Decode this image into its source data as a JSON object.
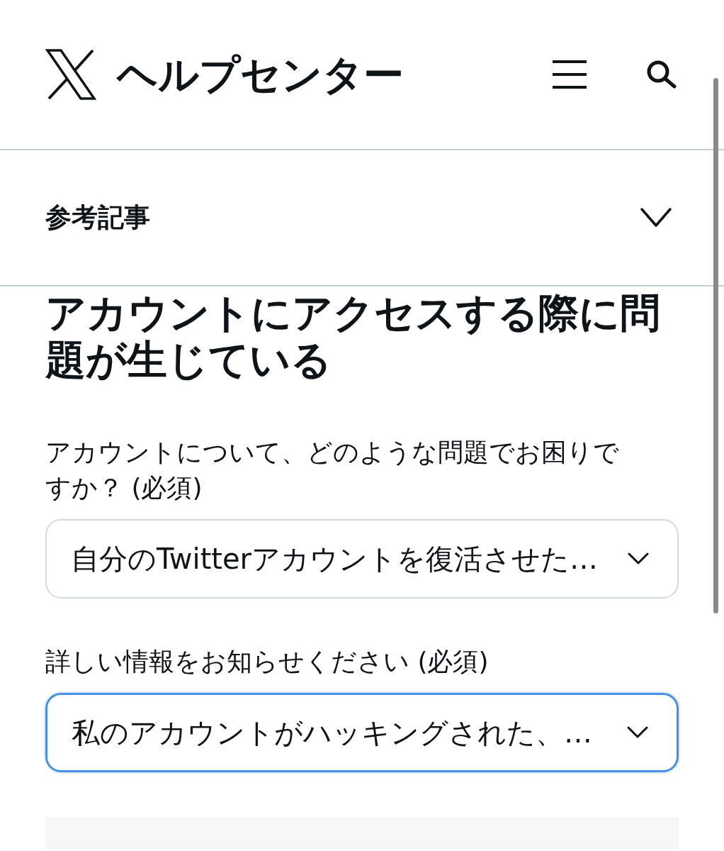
{
  "header": {
    "title": "ヘルプセンター"
  },
  "accordion": {
    "label": "参考記事",
    "expanded": false
  },
  "article": {
    "title": "アカウントにアクセスする際に問題が生じている"
  },
  "form": {
    "fields": [
      {
        "label": "アカウントについて、どのような問題でお困りですか？ (必須)",
        "value": "自分のTwitterアカウントを復活させた…",
        "focused": false
      },
      {
        "label": "詳しい情報をお知らせください (必須)",
        "value": "私のアカウントがハッキングされた、…",
        "focused": true
      }
    ]
  }
}
